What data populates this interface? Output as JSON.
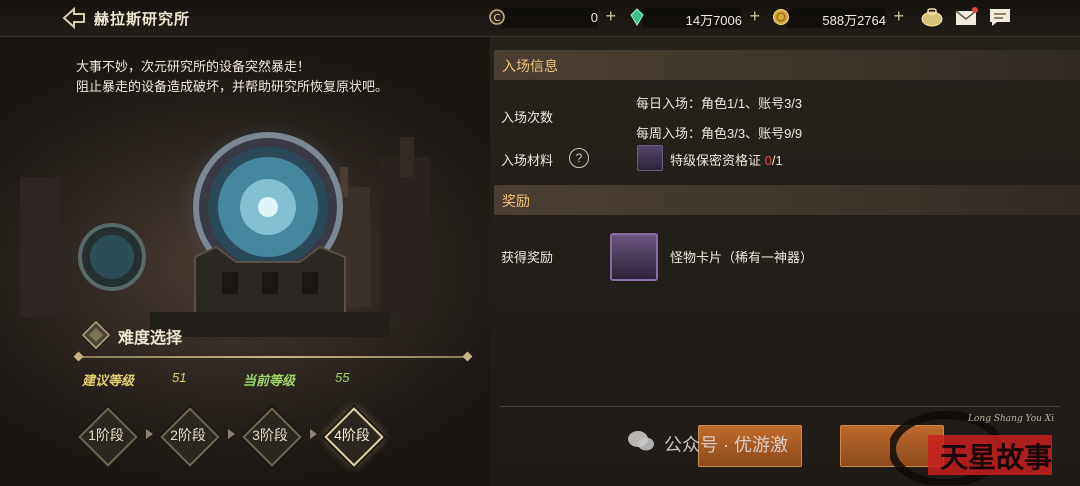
{
  "header": {
    "title": "赫拉斯研究所",
    "currencies": [
      {
        "icon": "coin-c-icon",
        "value": "0"
      },
      {
        "icon": "green-crystal-icon",
        "value": "14万7006"
      },
      {
        "icon": "gold-coin-icon",
        "value": "588万2764"
      }
    ],
    "icons": [
      "backpack-icon",
      "mail-icon",
      "chat-icon"
    ]
  },
  "description": {
    "line1": "大事不妙，次元研究所的设备突然暴走！",
    "line2": "阻止暴走的设备造成破坏，并帮助研究所恢复原状吧。"
  },
  "difficulty": {
    "title": "难度选择",
    "recommended_label": "建议等级",
    "recommended_value": "51",
    "current_label": "当前等级",
    "current_value": "55",
    "stages": [
      "1阶段",
      "2阶段",
      "3阶段",
      "4阶段"
    ],
    "selected_stage": "4阶段"
  },
  "entry_info": {
    "header": "入场信息",
    "count_label": "入场次数",
    "daily": "每日入场：角色1/1、账号3/3",
    "weekly": "每周入场：角色3/3、账号9/9",
    "material_label": "入场材料",
    "material_name": "特级保密资格证",
    "material_have": "0",
    "material_need": "/1"
  },
  "rewards": {
    "header": "奖励",
    "label": "获得奖励",
    "item": "怪物卡片（稀有一神器）"
  },
  "overlay": {
    "watermark": "公众号 · 优游激",
    "seal_text": "天星故事",
    "seal_script": "Long Shang You Xi"
  },
  "colors": {
    "section_header_text": "#f1c27a",
    "recommended_level_color": "#e0cf6a",
    "current_level_color": "#9ed36a",
    "material_missing": "#e04a3a",
    "action_button": "#c06a2c"
  }
}
